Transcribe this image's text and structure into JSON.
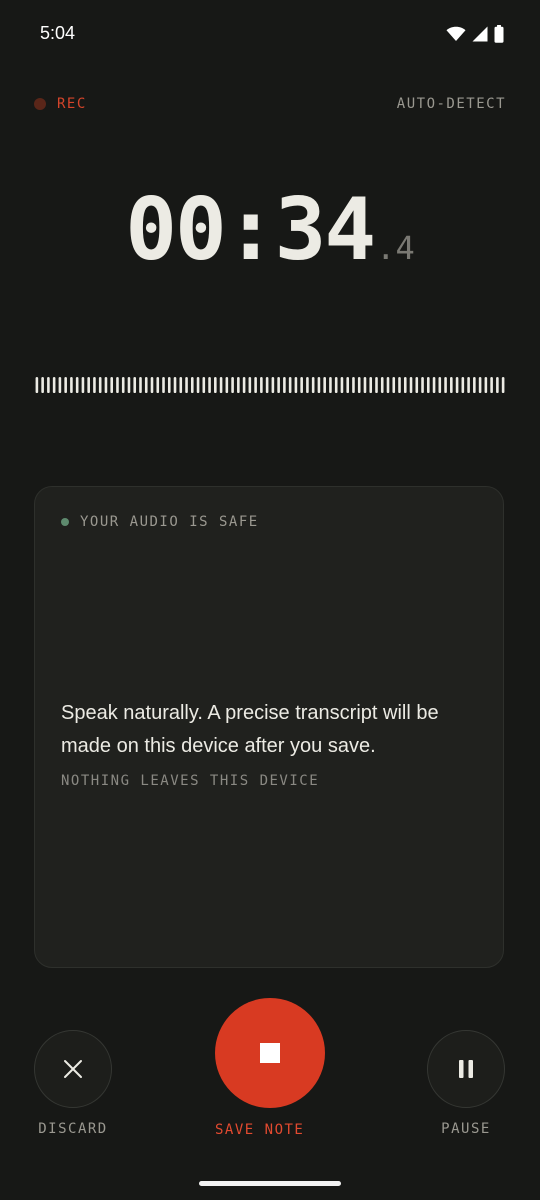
{
  "status_bar": {
    "time": "5:04",
    "icons": [
      "wifi-icon",
      "signal-icon",
      "battery-icon"
    ]
  },
  "recorder": {
    "rec_label": "REC",
    "language_mode": "AUTO-DETECT",
    "timer_main": "00:34",
    "timer_tenths": ".4",
    "waveform_bar_count": 82
  },
  "card": {
    "badge": "YOUR AUDIO IS SAFE",
    "prompt": "Speak naturally. A precise transcript will be made on this device after you save.",
    "subtext": "NOTHING LEAVES THIS DEVICE"
  },
  "controls": {
    "discard_label": "DISCARD",
    "save_label": "SAVE NOTE",
    "pause_label": "PAUSE"
  },
  "colors": {
    "background": "#171816",
    "accent": "#d83a22",
    "safe_dot": "#5e8a6e",
    "text": "#ecebe4",
    "muted": "#9a9890"
  }
}
